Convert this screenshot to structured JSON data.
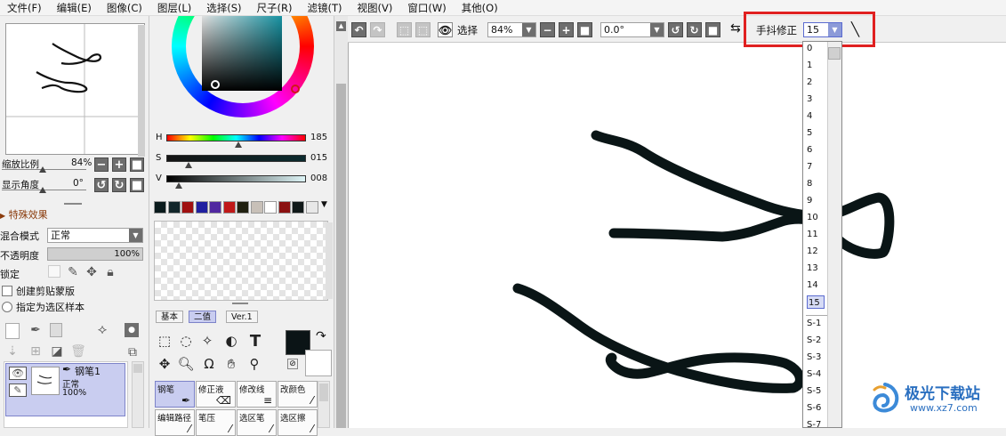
{
  "menu": [
    "文件(F)",
    "编辑(E)",
    "图像(C)",
    "图层(L)",
    "选择(S)",
    "尺子(R)",
    "滤镜(T)",
    "视图(V)",
    "窗口(W)",
    "其他(O)"
  ],
  "navigator": {
    "zoom_label": "缩放比例",
    "zoom_value": "84%",
    "angle_label": "显示角度",
    "angle_value": "0°"
  },
  "layer_panel": {
    "effects_title": "特殊效果",
    "blend_label": "混合模式",
    "blend_value": "正常",
    "opacity_label": "不透明度",
    "opacity_value": "100%",
    "opacity_fraction": 1.0,
    "lock_label": "锁定",
    "clip_label": "创建剪贴蒙版",
    "sample_label": "指定为选区样本",
    "layer": {
      "name": "钢笔1",
      "mode": "正常",
      "opacity": "100%"
    }
  },
  "color": {
    "h_label": "H",
    "h_value": "185",
    "s_label": "S",
    "s_value": "015",
    "v_label": "V",
    "v_value": "008",
    "swatches": [
      "#0a1a1c",
      "#12262a",
      "#a01010",
      "#2020a0",
      "#5028a0",
      "#c01818",
      "#202010",
      "#c8c0b8",
      "#ffffff",
      "#8b1010",
      "#101818",
      "#e8e8e8"
    ],
    "tabs": [
      "基本",
      "二值",
      "Ver.1"
    ],
    "active_tab": "二值",
    "primary_color": "#0b1416",
    "brushes": [
      {
        "label": "钢笔",
        "active": true
      },
      {
        "label": "修正液",
        "active": false
      },
      {
        "label": "修改线",
        "active": false
      },
      {
        "label": "改颜色",
        "active": false
      },
      {
        "label": "编辑路径",
        "active": false
      },
      {
        "label": "笔压",
        "active": false
      },
      {
        "label": "选区笔",
        "active": false
      },
      {
        "label": "选区擦",
        "active": false
      }
    ]
  },
  "toolbar": {
    "select_label": "选择",
    "zoom_value": "84%",
    "rotate_value": "0.0°",
    "stabilizer_label": "手抖修正",
    "stabilizer_value": "15"
  },
  "stabilizer_options": [
    "0",
    "1",
    "2",
    "3",
    "4",
    "5",
    "6",
    "7",
    "8",
    "9",
    "10",
    "11",
    "12",
    "13",
    "14",
    "15",
    "S-1",
    "S-2",
    "S-3",
    "S-4",
    "S-5",
    "S-6",
    "S-7"
  ],
  "stabilizer_selected": "15",
  "watermark": {
    "brand": "极光下载站",
    "url": "www.xz7.com"
  }
}
